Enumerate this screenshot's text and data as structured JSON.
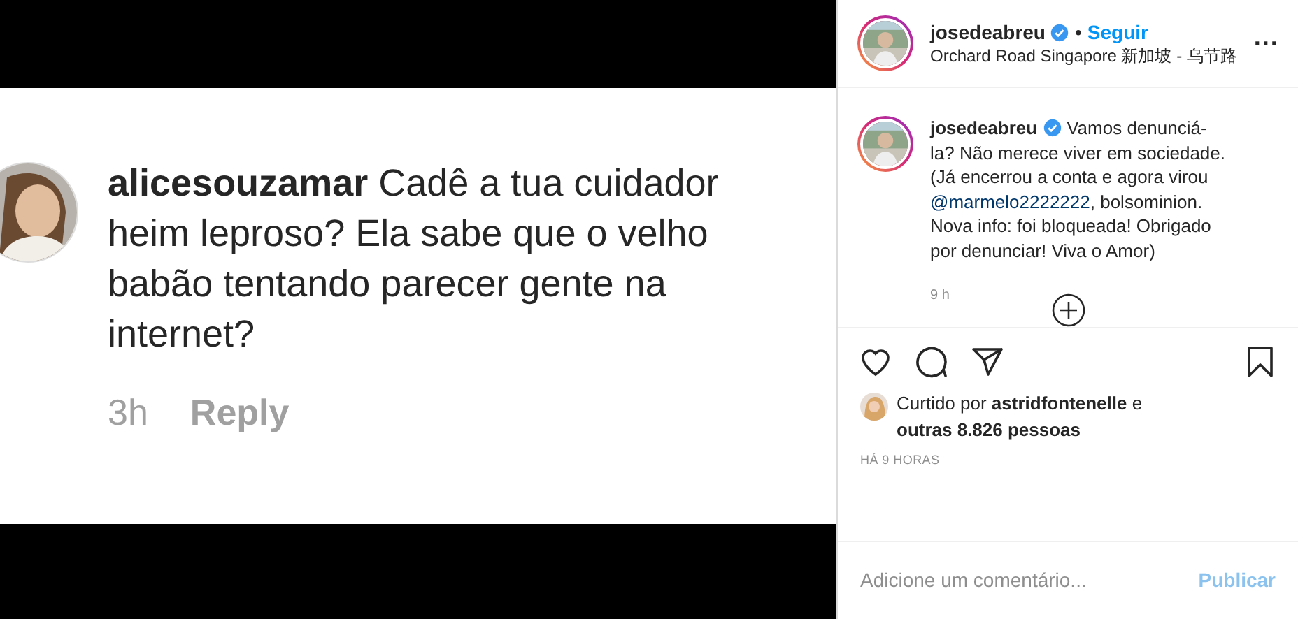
{
  "shared_image": {
    "comment": {
      "username": "alicesouzamar",
      "lines": [
        "Cadê a tua cuidador",
        "heim leproso? Ela sabe que o velho",
        "babão tentando parecer gente na",
        "internet?"
      ],
      "time": "3h",
      "reply": "Reply"
    }
  },
  "post_header": {
    "username": "josedeabreu",
    "verified": true,
    "separator": "•",
    "follow": "Seguir",
    "location": "Orchard Road Singapore 新加坡 - 乌节路",
    "more": "···"
  },
  "caption": {
    "username": "josedeabreu",
    "verified": true,
    "text_before": "Vamos denunciá-la? Não merece viver em sociedade. (Já encerrou a conta e agora virou",
    "mention": "@marmelo2222222",
    "text_after": ", bolsominion. Nova info: foi bloqueada! Obrigado por denunciar! Viva o Amor)",
    "time": "9 h"
  },
  "likes": {
    "prefix": "Curtido por",
    "user": "astridfontenelle",
    "joiner": "e",
    "others": "outras 8.826 pessoas"
  },
  "timestamp": "HÁ 9 HORAS",
  "comment_box": {
    "placeholder": "Adicione um comentário...",
    "submit": "Publicar",
    "disabled": true
  }
}
